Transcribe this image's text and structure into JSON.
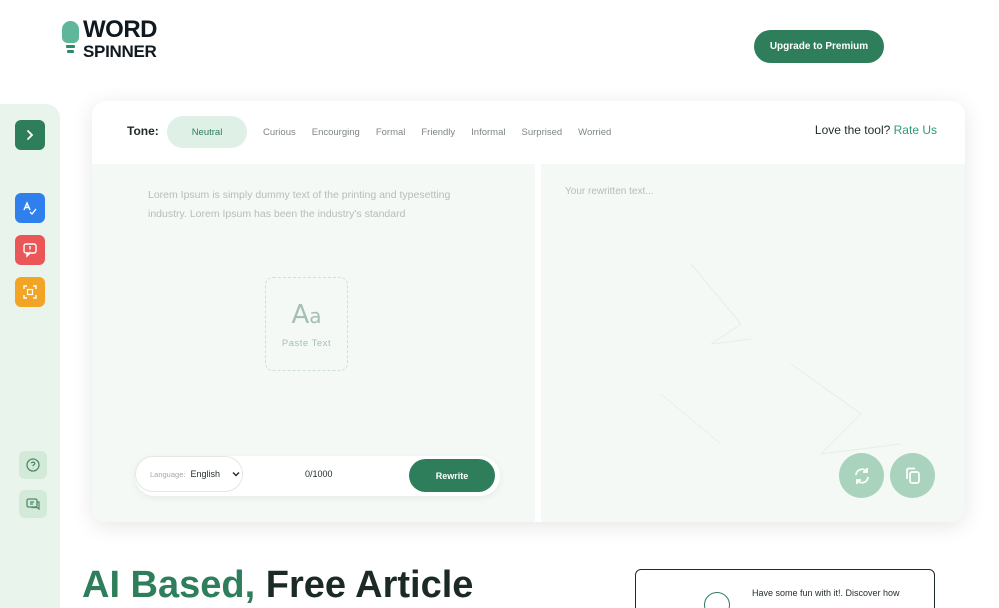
{
  "header": {
    "logo_line1": "WORD",
    "logo_line2": "SPINNER",
    "upgrade_label": "Upgrade to Premium"
  },
  "sidebar": {
    "expand_icon": "chevron-right-icon",
    "tools": [
      {
        "icon": "spellcheck-icon",
        "color": "#2f80ed"
      },
      {
        "icon": "chat-alert-icon",
        "color": "#eb5757"
      },
      {
        "icon": "scan-icon",
        "color": "#f2a524"
      }
    ],
    "help_icon": "help-icon",
    "feedback_icon": "chat-icon"
  },
  "tone": {
    "label": "Tone:",
    "options": [
      "Neutral",
      "Curious",
      "Encourging",
      "Formal",
      "Friendly",
      "Informal",
      "Surprised",
      "Worried"
    ],
    "selected": "Neutral"
  },
  "rate": {
    "prefix": "Love the tool?",
    "link": "Rate Us"
  },
  "input": {
    "text": "Lorem Ipsum is simply dummy text of the printing and typesetting industry. Lorem Ipsum has been the industry's standard",
    "paste_glyph": "A",
    "paste_glyph_small": "a",
    "paste_label": "Paste Text"
  },
  "controls": {
    "language_label": "Language:",
    "language_value": "English",
    "count": "0/1000",
    "rewrite_label": "Rewrite"
  },
  "output": {
    "placeholder": "Your rewritten text..."
  },
  "hero": {
    "accent": "AI Based,",
    "rest": "Free Article"
  },
  "promo": {
    "text": "Have some fun with it!. Discover how"
  },
  "colors": {
    "brand": "#2e7d5b",
    "panel": "#f4f9f5",
    "sidebar": "#e8f4ec"
  }
}
